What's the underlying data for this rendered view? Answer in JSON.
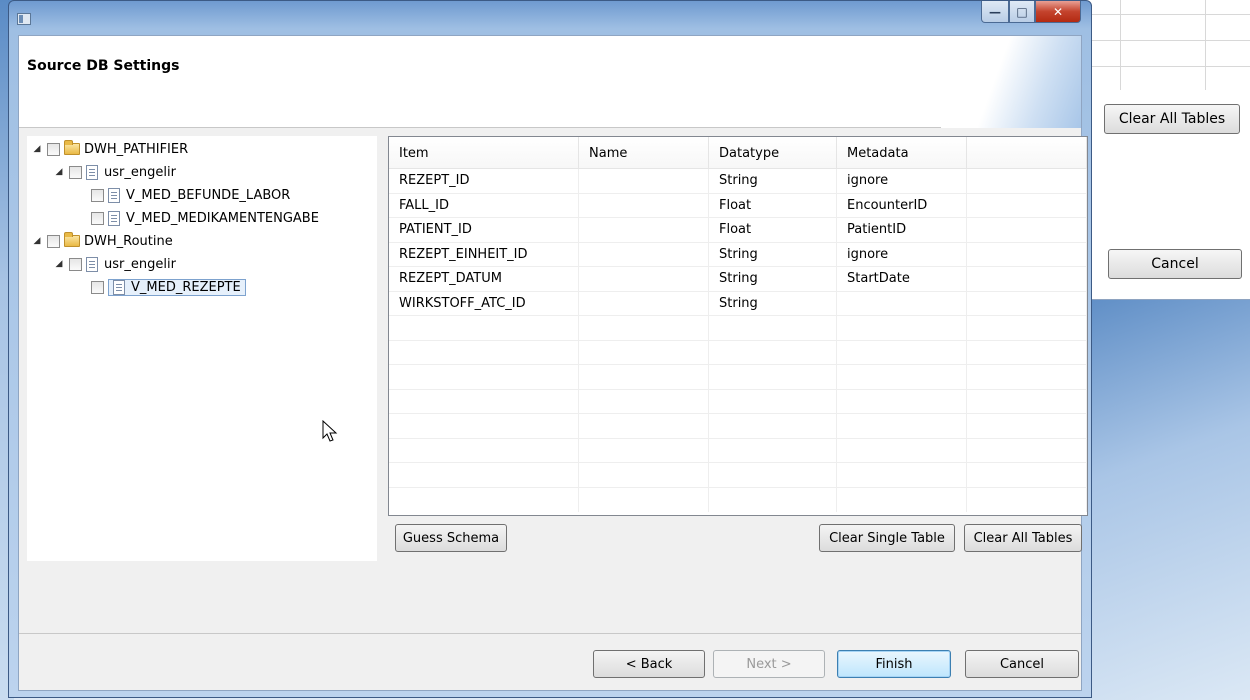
{
  "background": {
    "clear_all_tables_label": "Clear All Tables",
    "cancel_label": "Cancel"
  },
  "window": {
    "title": "",
    "controls": [
      "minimize-icon",
      "maximize-icon",
      "close-icon"
    ]
  },
  "header": {
    "title": "Source DB Settings"
  },
  "tree": {
    "nodes": [
      {
        "label": "DWH_PATHIFIER",
        "type": "folder",
        "level": 0,
        "expanded": true
      },
      {
        "label": "usr_engelir",
        "type": "schema",
        "level": 1,
        "expanded": true
      },
      {
        "label": "V_MED_BEFUNDE_LABOR",
        "type": "table",
        "level": 2
      },
      {
        "label": "V_MED_MEDIKAMENTENGABE",
        "type": "table",
        "level": 2
      },
      {
        "label": "DWH_Routine",
        "type": "folder",
        "level": 0,
        "expanded": true
      },
      {
        "label": "usr_engelir",
        "type": "schema",
        "level": 1,
        "expanded": true
      },
      {
        "label": "V_MED_REZEPTE",
        "type": "table",
        "level": 2,
        "selected": true
      }
    ]
  },
  "table": {
    "columns": [
      "Item",
      "Name",
      "Datatype",
      "Metadata",
      ""
    ],
    "rows": [
      [
        "REZEPT_ID",
        "",
        "String",
        "ignore",
        ""
      ],
      [
        "FALL_ID",
        "",
        "Float",
        "EncounterID",
        ""
      ],
      [
        "PATIENT_ID",
        "",
        "Float",
        "PatientID",
        ""
      ],
      [
        "REZEPT_EINHEIT_ID",
        "",
        "String",
        "ignore",
        ""
      ],
      [
        "REZEPT_DATUM",
        "",
        "String",
        "StartDate",
        ""
      ],
      [
        "WIRKSTOFF_ATC_ID",
        "",
        "String",
        "",
        ""
      ]
    ],
    "empty_rows": 8
  },
  "table_actions": {
    "guess_schema": "Guess Schema",
    "clear_single_table": "Clear Single Table",
    "clear_all_tables": "Clear All Tables"
  },
  "footer": {
    "back": "< Back",
    "next": "Next >",
    "finish": "Finish",
    "cancel": "Cancel"
  }
}
